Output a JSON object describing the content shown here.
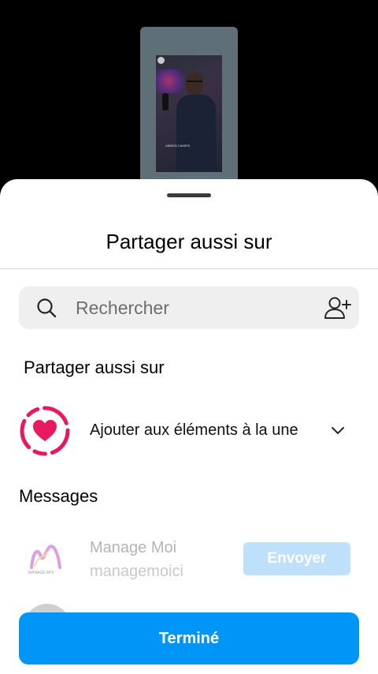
{
  "story_preview": {
    "caption": "ABBEDI CAMPIS"
  },
  "sheet": {
    "title": "Partager aussi sur",
    "search": {
      "placeholder": "Rechercher",
      "icon": "search-icon",
      "add_icon": "add-person-icon"
    },
    "share_section_label": "Partager aussi sur",
    "highlight": {
      "label": "Ajouter aux éléments à la une",
      "icon": "highlight-heart-icon",
      "accent": "#e8195e"
    },
    "messages_label": "Messages",
    "contacts": [
      {
        "name": "Manage Moi",
        "username": "managemoici",
        "logo_text": "MANAGE MOI",
        "send_label": "Envoyer"
      }
    ],
    "done_label": "Terminé"
  },
  "colors": {
    "primary_blue": "#0095f6",
    "disabled_blue": "#bfe0fb",
    "search_bg": "#efefef"
  }
}
